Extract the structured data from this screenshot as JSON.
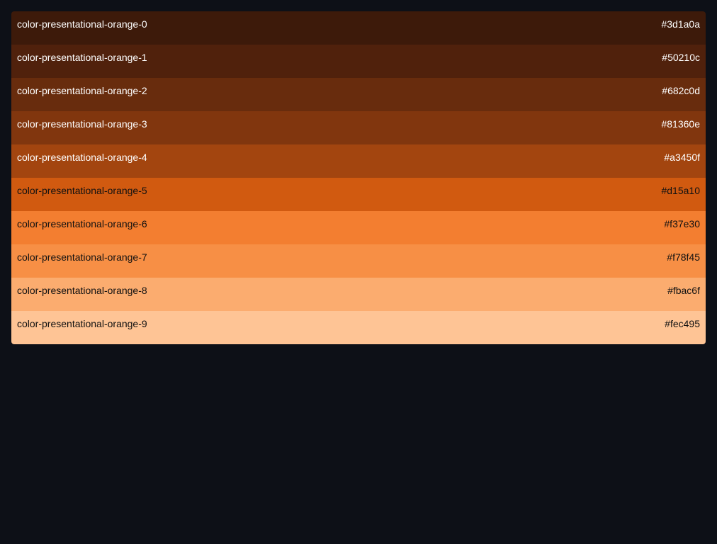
{
  "palette": {
    "swatches": [
      {
        "name": "color-presentational-orange-0",
        "hex": "#3d1a0a",
        "text_color": "#ffffff"
      },
      {
        "name": "color-presentational-orange-1",
        "hex": "#50210c",
        "text_color": "#ffffff"
      },
      {
        "name": "color-presentational-orange-2",
        "hex": "#682c0d",
        "text_color": "#ffffff"
      },
      {
        "name": "color-presentational-orange-3",
        "hex": "#81360e",
        "text_color": "#ffffff"
      },
      {
        "name": "color-presentational-orange-4",
        "hex": "#a3450f",
        "text_color": "#ffffff"
      },
      {
        "name": "color-presentational-orange-5",
        "hex": "#d15a10",
        "text_color": "#111111"
      },
      {
        "name": "color-presentational-orange-6",
        "hex": "#f37e30",
        "text_color": "#111111"
      },
      {
        "name": "color-presentational-orange-7",
        "hex": "#f78f45",
        "text_color": "#111111"
      },
      {
        "name": "color-presentational-orange-8",
        "hex": "#fbac6f",
        "text_color": "#111111"
      },
      {
        "name": "color-presentational-orange-9",
        "hex": "#fec495",
        "text_color": "#111111"
      }
    ]
  }
}
